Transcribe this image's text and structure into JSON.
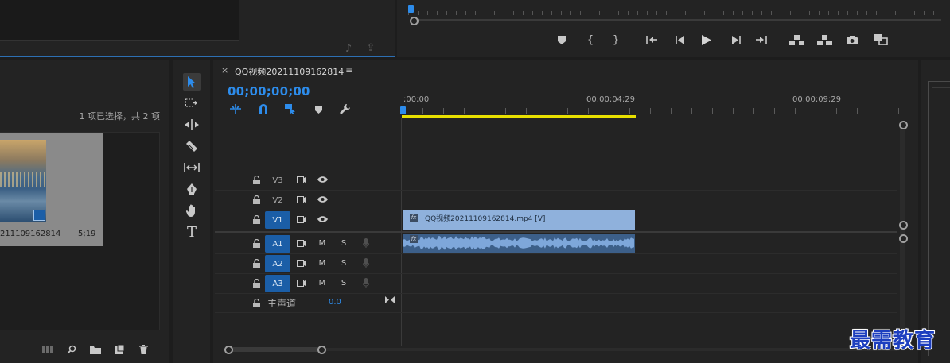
{
  "monitor": {
    "transport_buttons": [
      {
        "icon": "add-marker-icon"
      },
      {
        "icon": "mark-in-icon"
      },
      {
        "icon": "mark-out-icon"
      },
      {
        "icon": "go-to-in-icon"
      },
      {
        "icon": "step-back-icon"
      },
      {
        "icon": "play-icon"
      },
      {
        "icon": "step-forward-icon"
      },
      {
        "icon": "go-to-out-icon"
      },
      {
        "icon": "lift-icon"
      },
      {
        "icon": "extract-icon"
      },
      {
        "icon": "export-frame-icon"
      },
      {
        "icon": "comparison-view-icon"
      }
    ]
  },
  "project": {
    "selection_status": "1 项已选择，共 2 项",
    "clip_name": "211109162814",
    "clip_duration": "5;19",
    "footer_icons": [
      "list-view-icon",
      "find-icon",
      "new-bin-icon",
      "new-item-icon",
      "clear-icon"
    ]
  },
  "tools": [
    "selection-tool-icon",
    "track-select-tool-icon",
    "ripple-edit-tool-icon",
    "razor-tool-icon",
    "slip-tool-icon",
    "pen-tool-icon",
    "hand-tool-icon",
    "type-tool-icon"
  ],
  "timeline": {
    "tab_close": "×",
    "sequence_name": "QQ视频20211109162814",
    "menu_icon": "≡",
    "timecode": "00;00;00;00",
    "ruler_labels": [
      ";00;00",
      "00;00;04;29",
      "00;00;09;29"
    ],
    "tracks": {
      "video": [
        {
          "name": "V3",
          "active": false
        },
        {
          "name": "V2",
          "active": false
        },
        {
          "name": "V1",
          "active": true
        }
      ],
      "audio": [
        {
          "name": "A1",
          "m": "M",
          "s": "S"
        },
        {
          "name": "A2",
          "m": "M",
          "s": "S"
        },
        {
          "name": "A3",
          "m": "M",
          "s": "S"
        }
      ],
      "master": {
        "name": "主声道",
        "value": "0.0"
      }
    },
    "video_clip_label": "QQ视频20211109162814.mp4 [V]",
    "clip_fx_badge": "fx"
  },
  "colors": {
    "accent_blue": "#2d8ceb",
    "clip_video": "#8fb1dc",
    "clip_audio": "#6e9ad1",
    "work_area": "#e8e000",
    "track_active": "#1b5ea7"
  },
  "watermark": "最需教育"
}
